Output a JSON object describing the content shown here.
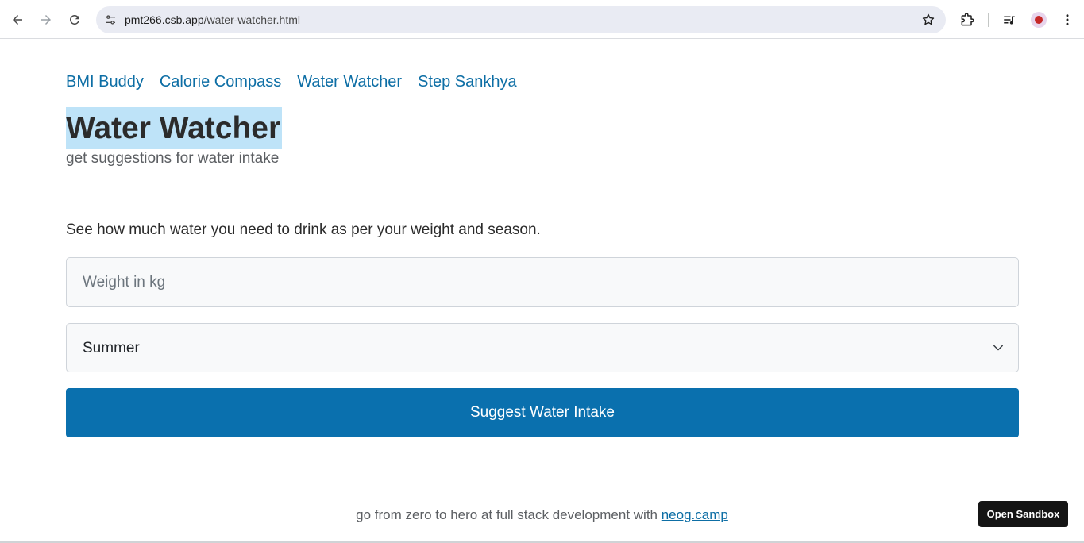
{
  "browser": {
    "url_host": "pmt266.csb.app",
    "url_path": "/water-watcher.html",
    "icons": {
      "back": "arrow-left-icon",
      "forward": "arrow-right-icon",
      "reload": "reload-icon",
      "site_info": "tune-icon",
      "bookmark": "star-icon",
      "extensions": "puzzle-icon",
      "media": "media-queue-icon",
      "profile": "avatar",
      "menu": "kebab-menu-icon"
    }
  },
  "nav": {
    "links": [
      "BMI Buddy",
      "Calorie Compass",
      "Water Watcher",
      "Step Sankhya"
    ]
  },
  "header": {
    "title": "Water Watcher",
    "subtitle": "get suggestions for water intake"
  },
  "main": {
    "description": "See how much water you need to drink as per your weight and season.",
    "weight_placeholder": "Weight in kg",
    "weight_value": "",
    "season_selected": "Summer",
    "submit_label": "Suggest Water Intake"
  },
  "footer": {
    "text": "go from zero to hero at full stack development with ",
    "link_text": "neog.camp"
  },
  "sandbox": {
    "label": "Open Sandbox"
  },
  "colors": {
    "link": "#0d6ea5",
    "primary_button": "#0a70ae",
    "title_highlight": "#bee3f8"
  }
}
